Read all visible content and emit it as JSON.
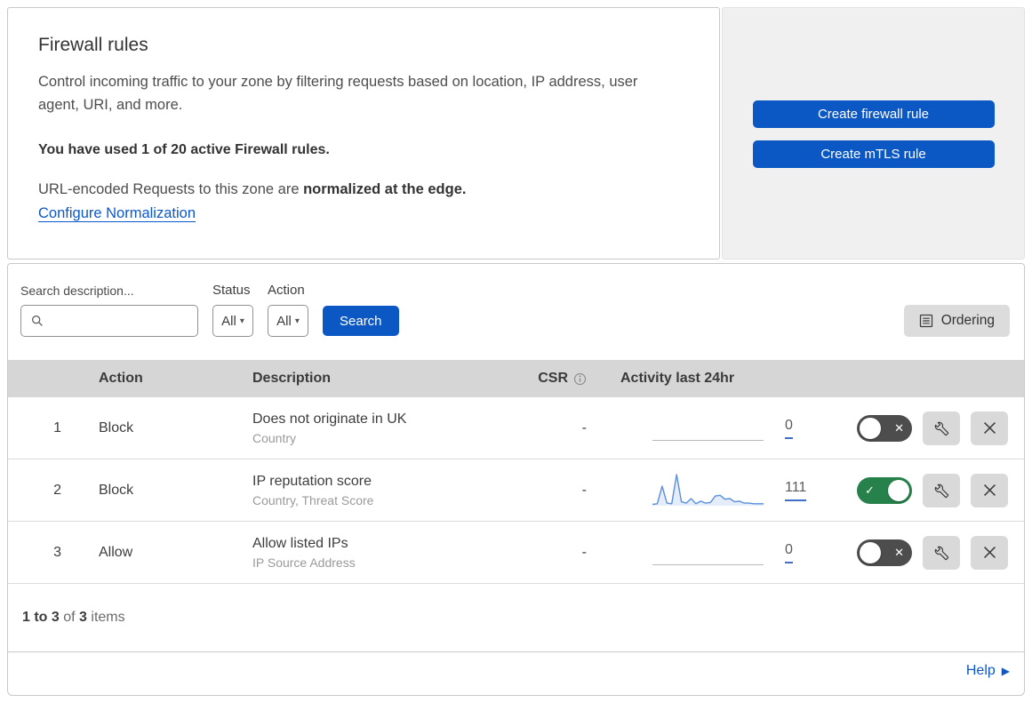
{
  "intro": {
    "title": "Firewall rules",
    "description": "Control incoming traffic to your zone by filtering requests based on location, IP address, user agent, URI, and more.",
    "usage": "You have used 1 of 20 active Firewall rules.",
    "normalization_prefix": "URL-encoded Requests to this zone are ",
    "normalization_bold": "normalized at the edge.",
    "normalization_link": "Configure Normalization"
  },
  "cta": {
    "create_firewall_rule": "Create firewall rule",
    "create_mtls_rule": "Create mTLS rule"
  },
  "filters": {
    "search_label": "Search description...",
    "status_label": "Status",
    "status_value": "All",
    "action_label": "Action",
    "action_value": "All",
    "search_button": "Search",
    "ordering_button": "Ordering"
  },
  "table": {
    "headers": {
      "action": "Action",
      "description": "Description",
      "csr": "CSR",
      "activity": "Activity last 24hr"
    },
    "rows": [
      {
        "priority": "1",
        "action": "Block",
        "description": "Does not originate in UK",
        "fields": "Country",
        "csr": "-",
        "activity_count": "0",
        "enabled": false
      },
      {
        "priority": "2",
        "action": "Block",
        "description": "IP reputation score",
        "fields": "Country, Threat Score",
        "csr": "-",
        "activity_count": "111",
        "enabled": true,
        "sparkline": [
          2,
          3,
          30,
          4,
          3,
          48,
          6,
          4,
          11,
          3,
          7,
          4,
          5,
          15,
          16,
          10,
          11,
          6,
          7,
          4,
          4,
          3,
          3,
          3
        ]
      },
      {
        "priority": "3",
        "action": "Allow",
        "description": "Allow listed IPs",
        "fields": "IP Source Address",
        "csr": "-",
        "activity_count": "0",
        "enabled": false
      }
    ]
  },
  "pagination": {
    "range": "1 to 3",
    "of": " of ",
    "total": "3",
    "items": " items"
  },
  "help": {
    "label": "Help",
    "arrow": "▶"
  },
  "icons": {
    "dropdown_arrow": "▾",
    "toggle_check": "✓",
    "toggle_x": "✕"
  },
  "colors": {
    "primary_blue": "#0b58c5",
    "link_blue": "#0b58cb",
    "toggle_on_green": "#27814a",
    "toggle_off_gray": "#4d4d4d",
    "table_header_gray": "#d6d6d6",
    "panel_gray": "#f0f0f0",
    "sparkline_blue": "#5a8fdb"
  }
}
